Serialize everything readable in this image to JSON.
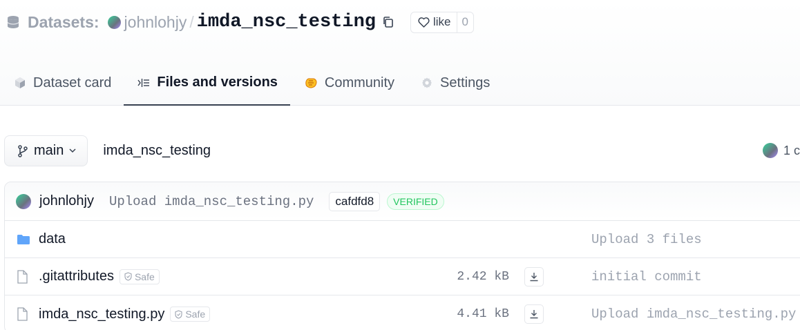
{
  "header": {
    "section_label": "Datasets:",
    "owner": "johnlohjy",
    "separator": "/",
    "repo_name": "imda_nsc_testing",
    "like_label": "like",
    "like_count": "0"
  },
  "tabs": [
    {
      "label": "Dataset card",
      "icon": "dataset-card-icon",
      "active": false
    },
    {
      "label": "Files and versions",
      "icon": "files-icon",
      "active": true
    },
    {
      "label": "Community",
      "icon": "community-icon",
      "active": false
    },
    {
      "label": "Settings",
      "icon": "gear-icon",
      "active": false
    }
  ],
  "branch": {
    "name": "main",
    "path": "imda_nsc_testing",
    "contributors_text": "1 c"
  },
  "last_commit": {
    "author": "johnlohjy",
    "message": "Upload imda_nsc_testing.py",
    "hash": "cafdfd8",
    "status": "VERIFIED"
  },
  "files": [
    {
      "name": "data",
      "type": "folder",
      "size": "",
      "safe": "",
      "commit": "Upload 3 files"
    },
    {
      "name": ".gitattributes",
      "type": "file",
      "size": "2.42 kB",
      "safe": "Safe",
      "commit": "initial commit"
    },
    {
      "name": "imda_nsc_testing.py",
      "type": "file",
      "size": "4.41 kB",
      "safe": "Safe",
      "commit": "Upload imda_nsc_testing.py"
    }
  ],
  "colors": {
    "accent": "#111827",
    "muted": "#9ca3af",
    "verified": "#22c55e",
    "folder": "#60a5fa"
  }
}
